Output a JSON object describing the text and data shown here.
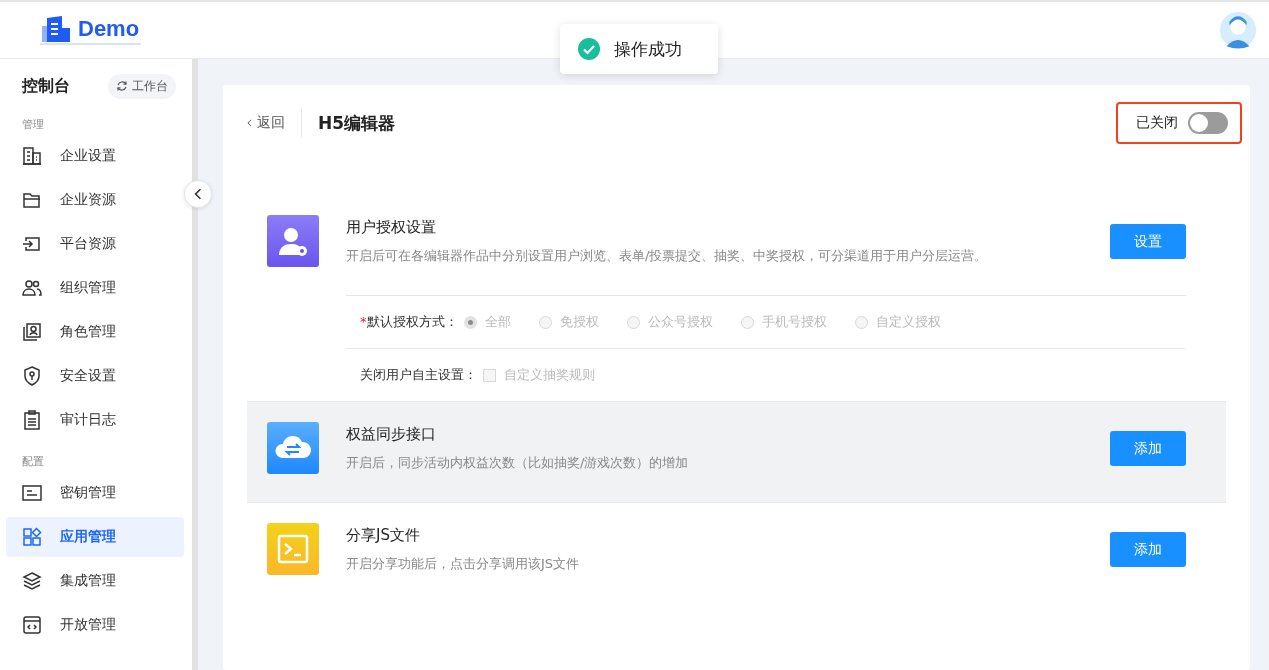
{
  "header": {
    "logo_text": "Demo"
  },
  "toast": {
    "message": "操作成功"
  },
  "sidebar": {
    "title": "控制台",
    "workbench_button": "工作台",
    "groups": [
      {
        "label": "管理",
        "items": [
          {
            "label": "企业设置",
            "selected": false
          },
          {
            "label": "企业资源",
            "selected": false
          },
          {
            "label": "平台资源",
            "selected": false
          },
          {
            "label": "组织管理",
            "selected": false
          },
          {
            "label": "角色管理",
            "selected": false
          },
          {
            "label": "安全设置",
            "selected": false
          },
          {
            "label": "审计日志",
            "selected": false
          }
        ]
      },
      {
        "label": "配置",
        "items": [
          {
            "label": "密钥管理",
            "selected": false
          },
          {
            "label": "应用管理",
            "selected": true
          },
          {
            "label": "集成管理",
            "selected": false
          },
          {
            "label": "开放管理",
            "selected": false
          }
        ]
      }
    ]
  },
  "page": {
    "back": "返回",
    "title": "H5编辑器",
    "toggle": {
      "label": "已关闭",
      "on": false,
      "highlighted": true
    },
    "features": [
      {
        "kind": "user",
        "title": "用户授权设置",
        "description": "开启后可在各编辑器作品中分别设置用户浏览、表单/投票提交、抽奖、中奖授权，可分渠道用于用户分层运营。",
        "button": "设置",
        "hovered": false,
        "settings": {
          "radio_label": "默认授权方式：",
          "required_mark": "*",
          "options": [
            {
              "label": "全部",
              "selected": true,
              "disabled": true
            },
            {
              "label": "免授权",
              "selected": false,
              "disabled": true
            },
            {
              "label": "公众号授权",
              "selected": false,
              "disabled": true
            },
            {
              "label": "手机号授权",
              "selected": false,
              "disabled": true
            },
            {
              "label": "自定义授权",
              "selected": false,
              "disabled": true
            }
          ],
          "checkbox_label": "关闭用户自主设置：",
          "checkbox": {
            "label": "自定义抽奖规则",
            "checked": false,
            "disabled": true
          }
        }
      },
      {
        "kind": "cloud",
        "title": "权益同步接口",
        "description": "开启后，同步活动内权益次数（比如抽奖/游戏次数）的增加",
        "button": "添加",
        "hovered": true
      },
      {
        "kind": "terminal",
        "title": "分享JS文件",
        "description": "开启分享功能后，点击分享调用该JS文件",
        "button": "添加",
        "hovered": false
      }
    ]
  }
}
